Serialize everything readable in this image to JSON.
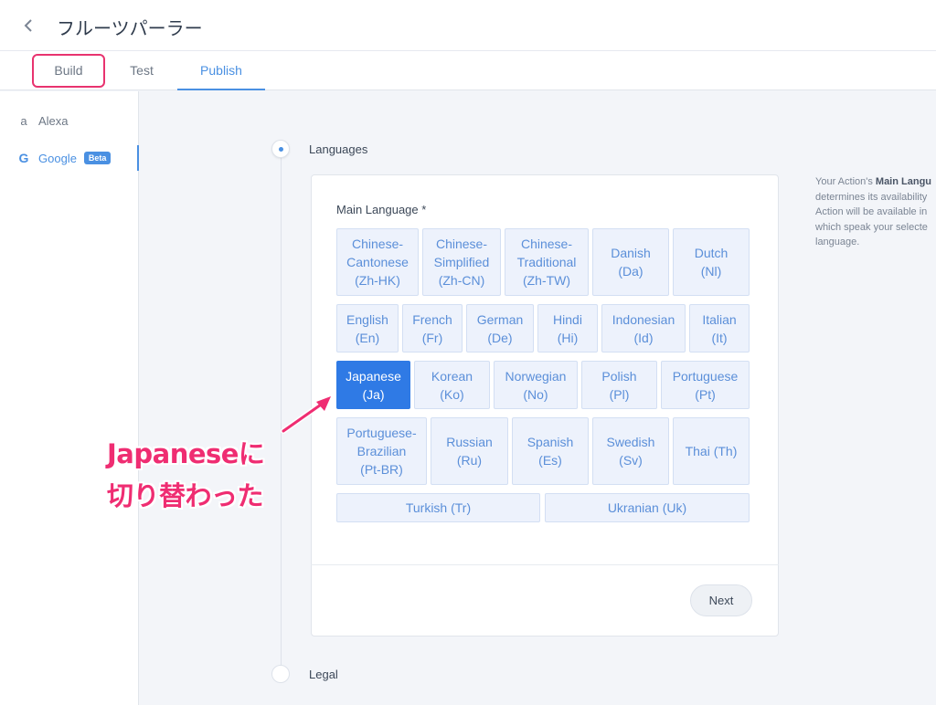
{
  "header": {
    "title": "フルーツパーラー"
  },
  "tabs": [
    {
      "label": "Build"
    },
    {
      "label": "Test"
    },
    {
      "label": "Publish"
    }
  ],
  "sidebar": {
    "items": [
      {
        "label": "Alexa",
        "icon": "amazon-icon"
      },
      {
        "label": "Google",
        "icon": "google-icon",
        "badge": "Beta"
      }
    ]
  },
  "steps": {
    "languages": "Languages",
    "legal": "Legal"
  },
  "form": {
    "main_language_label": "Main Language *",
    "languages": [
      {
        "line1": "Chinese-",
        "line2": "Cantonese",
        "line3": "(Zh-HK)"
      },
      {
        "line1": "Chinese-",
        "line2": "Simplified",
        "line3": "(Zh-CN)"
      },
      {
        "line1": "Chinese-",
        "line2": "Traditional",
        "line3": "(Zh-TW)"
      },
      {
        "line1": "Danish",
        "line2": "(Da)"
      },
      {
        "line1": "Dutch",
        "line2": "(Nl)"
      },
      {
        "line1": "English",
        "line2": "(En)"
      },
      {
        "line1": "French",
        "line2": "(Fr)"
      },
      {
        "line1": "German",
        "line2": "(De)"
      },
      {
        "line1": "Hindi",
        "line2": "(Hi)"
      },
      {
        "line1": "Indonesian",
        "line2": "(Id)"
      },
      {
        "line1": "Italian",
        "line2": "(It)"
      },
      {
        "line1": "Japanese",
        "line2": "(Ja)"
      },
      {
        "line1": "Korean",
        "line2": "(Ko)"
      },
      {
        "line1": "Norwegian",
        "line2": "(No)"
      },
      {
        "line1": "Polish",
        "line2": "(Pl)"
      },
      {
        "line1": "Portuguese",
        "line2": "(Pt)"
      },
      {
        "line1": "Portuguese-",
        "line2": "Brazilian",
        "line3": "(Pt-BR)"
      },
      {
        "line1": "Russian",
        "line2": "(Ru)"
      },
      {
        "line1": "Spanish",
        "line2": "(Es)"
      },
      {
        "line1": "Swedish",
        "line2": "(Sv)"
      },
      {
        "line1": "Thai (Th)"
      },
      {
        "line1": "Turkish (Tr)"
      },
      {
        "line1": "Ukranian (Uk)"
      }
    ],
    "selected_language": "Japanese (Ja)",
    "next_label": "Next"
  },
  "help": {
    "line1_prefix": "Your Action's ",
    "line1_bold": "Main Langu",
    "line2": "determines its availability",
    "line3": "Action will be available in",
    "line4": "which speak your selecte",
    "line5": "language."
  },
  "annotation": {
    "line1": "Japaneseに",
    "line2": "切り替わった"
  },
  "colors": {
    "accent": "#4a90e2",
    "selected": "#2f7ae5",
    "annotation": "#ef2d72"
  }
}
